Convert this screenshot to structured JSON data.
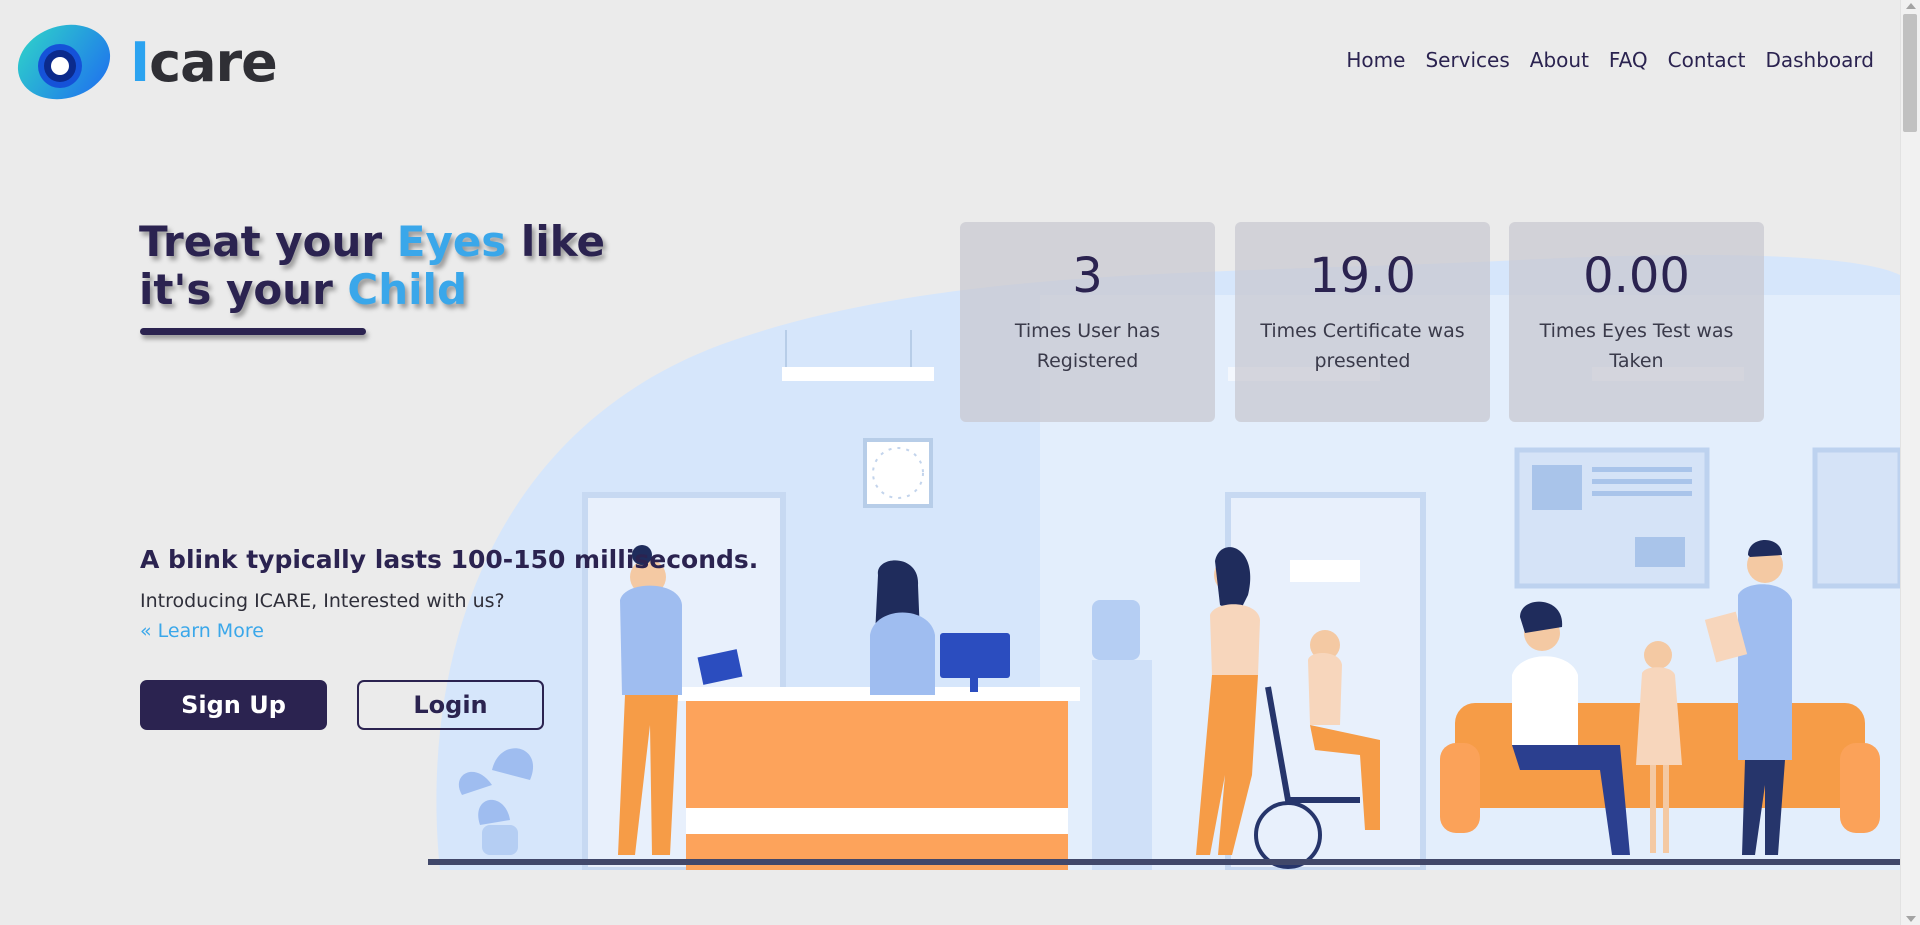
{
  "brand": {
    "initial": "I",
    "rest": "care"
  },
  "nav": [
    "Home",
    "Services",
    "About",
    "FAQ",
    "Contact",
    "Dashboard"
  ],
  "hero": {
    "line1_a": "Treat your ",
    "line1_hl": "Eyes",
    "line1_b": " like",
    "line2_a": "it's your ",
    "line2_hl": "Child"
  },
  "stats": [
    {
      "value": "3",
      "label": "Times User has Registered"
    },
    {
      "value": "19.0",
      "label": "Times Certificate was presented"
    },
    {
      "value": "0.00",
      "label": "Times Eyes Test was Taken"
    }
  ],
  "tagline": "A blink typically lasts 100-150 milliseconds.",
  "intro": "Introducing ICARE, Interested with us?",
  "learn_more": "« Learn More",
  "buttons": {
    "signup": "Sign Up",
    "login": "Login"
  },
  "colors": {
    "primary": "#2b2350",
    "accent": "#3aa7ea",
    "background": "#ebebeb"
  }
}
